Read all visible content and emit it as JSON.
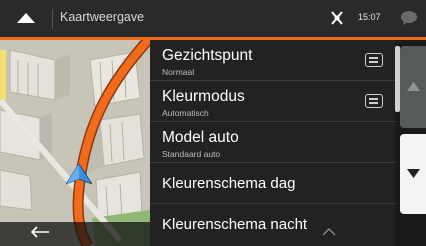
{
  "header": {
    "title": "Kaartweergave",
    "time": "15:07",
    "up_icon": "chevron-up-icon",
    "gps_icon": "satellite-icon",
    "message_icon": "speech-bubble-icon"
  },
  "menu": {
    "items": [
      {
        "label": "Gezichtspunt",
        "value": "Normaal",
        "icon": "list-icon"
      },
      {
        "label": "Kleurmodus",
        "value": "Automatisch",
        "icon": "list-icon"
      },
      {
        "label": "Model auto",
        "value": "Standaard auto"
      },
      {
        "label": "Kleurenschema dag"
      },
      {
        "label": "Kleurenschema nacht"
      }
    ]
  },
  "navigation": {
    "back_icon": "back-arrow-icon",
    "scroll_up_icon": "triangle-up-icon",
    "scroll_down_icon": "triangle-down-icon"
  },
  "colors": {
    "accent": "#f26a1b",
    "route": "#f26a1b",
    "position_marker": "#3a8fe0",
    "menu_bg": "#222222"
  }
}
